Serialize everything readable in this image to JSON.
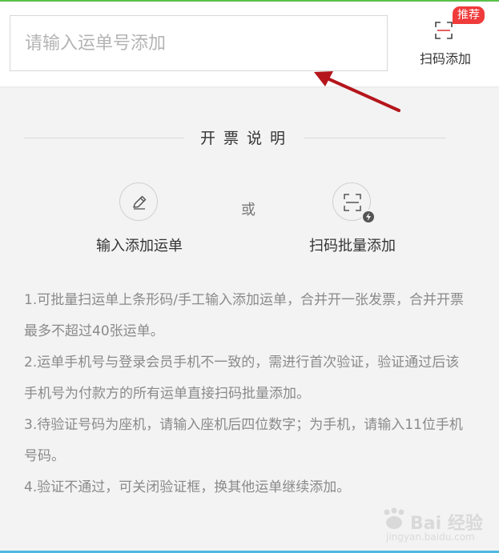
{
  "search": {
    "placeholder": "请输入运单号添加",
    "value": ""
  },
  "scan": {
    "label": "扫码添加",
    "badge": "推荐",
    "icon": "scan-frame-icon"
  },
  "section": {
    "title": "开票说明"
  },
  "methods": [
    {
      "label": "输入添加运单",
      "icon": "pencil-icon"
    },
    {
      "label": "扫码批量添加",
      "icon": "scan-batch-icon"
    }
  ],
  "or_text": "或",
  "notes": [
    "1.可批量扫运单上条形码/手工输入添加运单，合并开一张发票，合并开票最多不超过40张运单。",
    "2.运单手机号与登录会员手机不一致的，需进行首次验证，验证通过后该手机号为付款方的所有运单直接扫码批量添加。",
    "3.待验证号码为座机，请输入座机后四位数字；为手机，请输入11位手机号码。",
    "4.验证不通过，可关闭验证框，换其他运单继续添加。"
  ],
  "watermark": {
    "text": "Bai 经验",
    "sub": "jingyan.baidu.com"
  },
  "colors": {
    "accent_green": "#5bc04a",
    "badge_red": "#ef3b3b",
    "arrow_red": "#b4161c",
    "bottom_blue": "#4eb8e3"
  }
}
